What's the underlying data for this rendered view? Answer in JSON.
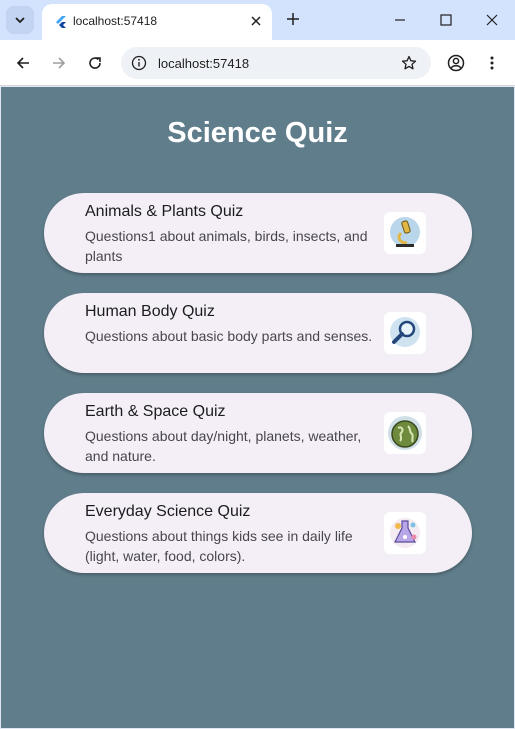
{
  "browser": {
    "tab_title": "localhost:57418",
    "url": "localhost:57418",
    "icons": [
      "chevron-down-icon",
      "flutter-icon",
      "close-icon",
      "plus-icon",
      "minimize-icon",
      "maximize-icon",
      "close-window-icon",
      "back-icon",
      "forward-icon",
      "reload-icon",
      "site-info-icon",
      "star-icon",
      "profile-icon",
      "more-icon"
    ]
  },
  "app": {
    "title": "Science Quiz",
    "background": "#607d8b",
    "card_color": "#f4eff7",
    "quizzes": [
      {
        "title": "Animals & Plants Quiz",
        "description": "Questions1 about animals, birds, insects, and plants",
        "icon": "microscope-icon"
      },
      {
        "title": "Human Body Quiz",
        "description": "Questions about basic body parts and senses.",
        "icon": "magnifier-icon"
      },
      {
        "title": "Earth & Space Quiz",
        "description": "Questions about day/night, planets, weather, and nature.",
        "icon": "globe-icon"
      },
      {
        "title": "Everyday Science Quiz",
        "description": "Questions about things kids see in daily life (light, water, food, colors).",
        "icon": "science-flask-icon"
      }
    ]
  }
}
